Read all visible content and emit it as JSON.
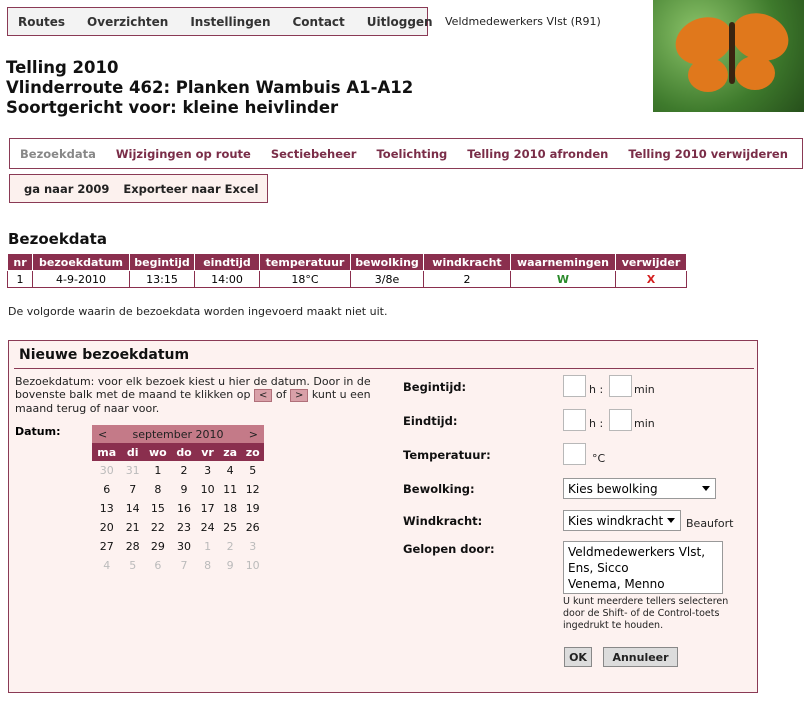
{
  "topnav": {
    "items": [
      "Routes",
      "Overzichten",
      "Instellingen",
      "Contact",
      "Uitloggen"
    ]
  },
  "user": {
    "label": "Veldmedewerkers Vlst (R91)"
  },
  "photo": {
    "icon": "butterfly-photo"
  },
  "titles": {
    "line1": "Telling 2010",
    "line2": "Vlinderroute 462: Planken Wambuis A1-A12",
    "line3": "Soortgericht voor: kleine heivlinder"
  },
  "subnav1": {
    "items": [
      "Bezoekdata",
      "Wijzigingen op route",
      "Sectiebeheer",
      "Toelichting",
      "Telling 2010 afronden",
      "Telling 2010 verwijderen"
    ]
  },
  "subnav2": {
    "items": [
      "ga naar 2009",
      "Exporteer naar Excel"
    ]
  },
  "bezoekdata": {
    "heading": "Bezoekdata",
    "columns": [
      "nr",
      "bezoekdatum",
      "begintijd",
      "eindtijd",
      "temperatuur",
      "bewolking",
      "windkracht",
      "waarnemingen",
      "verwijder"
    ],
    "rows": [
      {
        "nr": "1",
        "date": "4-9-2010",
        "start": "13:15",
        "end": "14:00",
        "temp": "18°C",
        "cloud": "3/8e",
        "wind": "2",
        "obs": "W",
        "del": "X"
      }
    ],
    "note": "De volgorde waarin de bezoekdata worden ingevoerd maakt niet uit."
  },
  "form": {
    "title": "Nieuwe bezoekdatum",
    "explain_a": "Bezoekdatum: voor elk bezoek kiest u hier de datum. Door in de bovenste balk met de maand te klikken op ",
    "explain_prev": "<",
    "explain_of": " of ",
    "explain_next": ">",
    "explain_b": " kunt u een maand terug of naar voor.",
    "datum_label": "Datum:",
    "begintijd_label": "Begintijd:",
    "eindtijd_label": "Eindtijd:",
    "temperatuur_label": "Temperatuur:",
    "bewolking_label": "Bewolking:",
    "windkracht_label": "Windkracht:",
    "gelopen_label": "Gelopen door:",
    "unit_h": "h :",
    "unit_min": "min",
    "unit_c": "°C",
    "unit_beaufort": "Beaufort",
    "bewolking_value": "Kies bewolking",
    "windkracht_value": "Kies windkracht",
    "gelopen_options": [
      "Veldmedewerkers Vlst,",
      "Ens, Sicco",
      "Venema, Menno"
    ],
    "gelopen_hint": "U kunt meerdere tellers selecteren door de Shift- of de Control-toets ingedrukt te houden.",
    "ok_label": "OK",
    "cancel_label": "Annuleer"
  },
  "calendar": {
    "month": "september 2010",
    "prev": "<",
    "next": ">",
    "weekdays": [
      "ma",
      "di",
      "wo",
      "do",
      "vr",
      "za",
      "zo"
    ],
    "weeks": [
      [
        "30",
        "31",
        "1",
        "2",
        "3",
        "4",
        "5"
      ],
      [
        "6",
        "7",
        "8",
        "9",
        "10",
        "11",
        "12"
      ],
      [
        "13",
        "14",
        "15",
        "16",
        "17",
        "18",
        "19"
      ],
      [
        "20",
        "21",
        "22",
        "23",
        "24",
        "25",
        "26"
      ],
      [
        "27",
        "28",
        "29",
        "30",
        "1",
        "2",
        "3"
      ],
      [
        "4",
        "5",
        "6",
        "7",
        "8",
        "9",
        "10"
      ]
    ]
  }
}
